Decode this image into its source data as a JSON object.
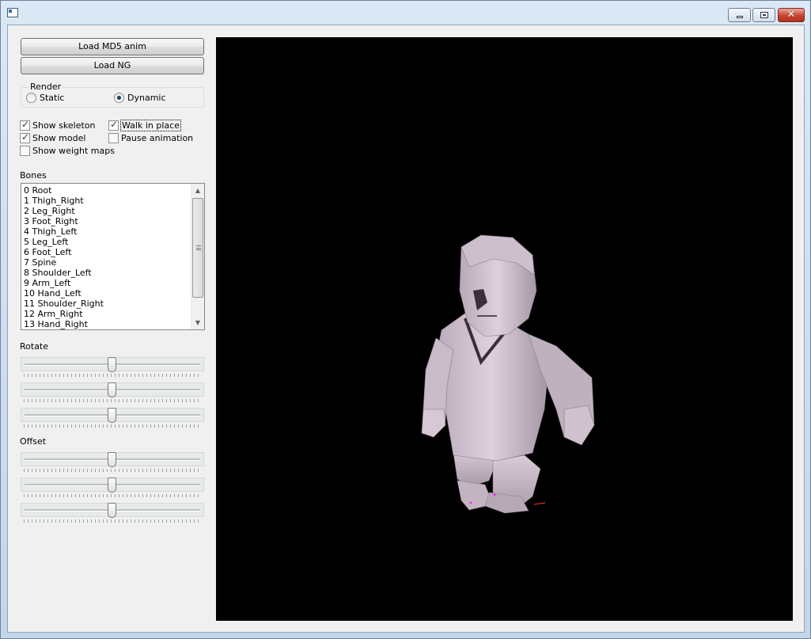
{
  "toolbar": {
    "load_md5_label": "Load MD5 anim",
    "load_ng_label": "Load NG"
  },
  "render": {
    "legend": "Render",
    "options": [
      {
        "label": "Static",
        "selected": false
      },
      {
        "label": "Dynamic",
        "selected": true
      }
    ]
  },
  "options": {
    "show_skeleton": {
      "label": "Show skeleton",
      "checked": true
    },
    "walk_in_place": {
      "label": "Walk in place",
      "checked": true
    },
    "show_model": {
      "label": "Show model",
      "checked": true
    },
    "pause_animation": {
      "label": "Pause animation",
      "checked": false
    },
    "show_weight_maps": {
      "label": "Show weight maps",
      "checked": false
    }
  },
  "bones": {
    "label": "Bones",
    "items": [
      "0 Root",
      "1 Thigh_Right",
      "2 Leg_Right",
      "3 Foot_Right",
      "4 Thigh_Left",
      "5 Leg_Left",
      "6 Foot_Left",
      "7 Spine",
      "8 Shoulder_Left",
      "9 Arm_Left",
      "10 Hand_Left",
      "11 Shoulder_Right",
      "12 Arm_Right",
      "13 Hand_Right"
    ]
  },
  "rotate": {
    "label": "Rotate",
    "sliders": [
      0.5,
      0.5,
      0.5
    ]
  },
  "offset": {
    "label": "Offset",
    "sliders": [
      0.5,
      0.5,
      0.5
    ]
  },
  "colors": {
    "viewport_bg": "#000000",
    "model": "#ddd0dc",
    "bone_marker": "#ff22ff"
  }
}
